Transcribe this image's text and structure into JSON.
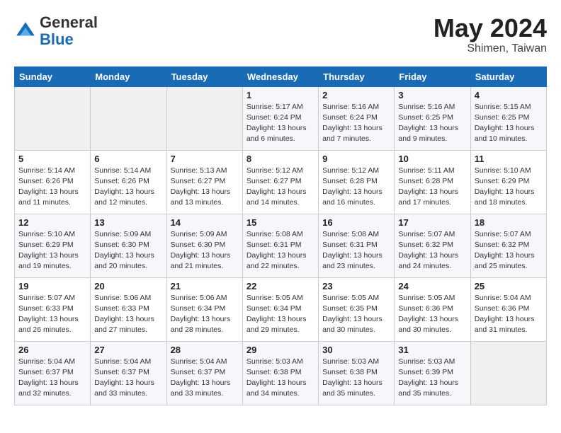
{
  "header": {
    "logo_general": "General",
    "logo_blue": "Blue",
    "month_title": "May 2024",
    "subtitle": "Shimen, Taiwan"
  },
  "days_of_week": [
    "Sunday",
    "Monday",
    "Tuesday",
    "Wednesday",
    "Thursday",
    "Friday",
    "Saturday"
  ],
  "weeks": [
    [
      {
        "day": "",
        "sunrise": "",
        "sunset": "",
        "daylight": ""
      },
      {
        "day": "",
        "sunrise": "",
        "sunset": "",
        "daylight": ""
      },
      {
        "day": "",
        "sunrise": "",
        "sunset": "",
        "daylight": ""
      },
      {
        "day": "1",
        "sunrise": "Sunrise: 5:17 AM",
        "sunset": "Sunset: 6:24 PM",
        "daylight": "Daylight: 13 hours and 6 minutes."
      },
      {
        "day": "2",
        "sunrise": "Sunrise: 5:16 AM",
        "sunset": "Sunset: 6:24 PM",
        "daylight": "Daylight: 13 hours and 7 minutes."
      },
      {
        "day": "3",
        "sunrise": "Sunrise: 5:16 AM",
        "sunset": "Sunset: 6:25 PM",
        "daylight": "Daylight: 13 hours and 9 minutes."
      },
      {
        "day": "4",
        "sunrise": "Sunrise: 5:15 AM",
        "sunset": "Sunset: 6:25 PM",
        "daylight": "Daylight: 13 hours and 10 minutes."
      }
    ],
    [
      {
        "day": "5",
        "sunrise": "Sunrise: 5:14 AM",
        "sunset": "Sunset: 6:26 PM",
        "daylight": "Daylight: 13 hours and 11 minutes."
      },
      {
        "day": "6",
        "sunrise": "Sunrise: 5:14 AM",
        "sunset": "Sunset: 6:26 PM",
        "daylight": "Daylight: 13 hours and 12 minutes."
      },
      {
        "day": "7",
        "sunrise": "Sunrise: 5:13 AM",
        "sunset": "Sunset: 6:27 PM",
        "daylight": "Daylight: 13 hours and 13 minutes."
      },
      {
        "day": "8",
        "sunrise": "Sunrise: 5:12 AM",
        "sunset": "Sunset: 6:27 PM",
        "daylight": "Daylight: 13 hours and 14 minutes."
      },
      {
        "day": "9",
        "sunrise": "Sunrise: 5:12 AM",
        "sunset": "Sunset: 6:28 PM",
        "daylight": "Daylight: 13 hours and 16 minutes."
      },
      {
        "day": "10",
        "sunrise": "Sunrise: 5:11 AM",
        "sunset": "Sunset: 6:28 PM",
        "daylight": "Daylight: 13 hours and 17 minutes."
      },
      {
        "day": "11",
        "sunrise": "Sunrise: 5:10 AM",
        "sunset": "Sunset: 6:29 PM",
        "daylight": "Daylight: 13 hours and 18 minutes."
      }
    ],
    [
      {
        "day": "12",
        "sunrise": "Sunrise: 5:10 AM",
        "sunset": "Sunset: 6:29 PM",
        "daylight": "Daylight: 13 hours and 19 minutes."
      },
      {
        "day": "13",
        "sunrise": "Sunrise: 5:09 AM",
        "sunset": "Sunset: 6:30 PM",
        "daylight": "Daylight: 13 hours and 20 minutes."
      },
      {
        "day": "14",
        "sunrise": "Sunrise: 5:09 AM",
        "sunset": "Sunset: 6:30 PM",
        "daylight": "Daylight: 13 hours and 21 minutes."
      },
      {
        "day": "15",
        "sunrise": "Sunrise: 5:08 AM",
        "sunset": "Sunset: 6:31 PM",
        "daylight": "Daylight: 13 hours and 22 minutes."
      },
      {
        "day": "16",
        "sunrise": "Sunrise: 5:08 AM",
        "sunset": "Sunset: 6:31 PM",
        "daylight": "Daylight: 13 hours and 23 minutes."
      },
      {
        "day": "17",
        "sunrise": "Sunrise: 5:07 AM",
        "sunset": "Sunset: 6:32 PM",
        "daylight": "Daylight: 13 hours and 24 minutes."
      },
      {
        "day": "18",
        "sunrise": "Sunrise: 5:07 AM",
        "sunset": "Sunset: 6:32 PM",
        "daylight": "Daylight: 13 hours and 25 minutes."
      }
    ],
    [
      {
        "day": "19",
        "sunrise": "Sunrise: 5:07 AM",
        "sunset": "Sunset: 6:33 PM",
        "daylight": "Daylight: 13 hours and 26 minutes."
      },
      {
        "day": "20",
        "sunrise": "Sunrise: 5:06 AM",
        "sunset": "Sunset: 6:33 PM",
        "daylight": "Daylight: 13 hours and 27 minutes."
      },
      {
        "day": "21",
        "sunrise": "Sunrise: 5:06 AM",
        "sunset": "Sunset: 6:34 PM",
        "daylight": "Daylight: 13 hours and 28 minutes."
      },
      {
        "day": "22",
        "sunrise": "Sunrise: 5:05 AM",
        "sunset": "Sunset: 6:34 PM",
        "daylight": "Daylight: 13 hours and 29 minutes."
      },
      {
        "day": "23",
        "sunrise": "Sunrise: 5:05 AM",
        "sunset": "Sunset: 6:35 PM",
        "daylight": "Daylight: 13 hours and 30 minutes."
      },
      {
        "day": "24",
        "sunrise": "Sunrise: 5:05 AM",
        "sunset": "Sunset: 6:36 PM",
        "daylight": "Daylight: 13 hours and 30 minutes."
      },
      {
        "day": "25",
        "sunrise": "Sunrise: 5:04 AM",
        "sunset": "Sunset: 6:36 PM",
        "daylight": "Daylight: 13 hours and 31 minutes."
      }
    ],
    [
      {
        "day": "26",
        "sunrise": "Sunrise: 5:04 AM",
        "sunset": "Sunset: 6:37 PM",
        "daylight": "Daylight: 13 hours and 32 minutes."
      },
      {
        "day": "27",
        "sunrise": "Sunrise: 5:04 AM",
        "sunset": "Sunset: 6:37 PM",
        "daylight": "Daylight: 13 hours and 33 minutes."
      },
      {
        "day": "28",
        "sunrise": "Sunrise: 5:04 AM",
        "sunset": "Sunset: 6:37 PM",
        "daylight": "Daylight: 13 hours and 33 minutes."
      },
      {
        "day": "29",
        "sunrise": "Sunrise: 5:03 AM",
        "sunset": "Sunset: 6:38 PM",
        "daylight": "Daylight: 13 hours and 34 minutes."
      },
      {
        "day": "30",
        "sunrise": "Sunrise: 5:03 AM",
        "sunset": "Sunset: 6:38 PM",
        "daylight": "Daylight: 13 hours and 35 minutes."
      },
      {
        "day": "31",
        "sunrise": "Sunrise: 5:03 AM",
        "sunset": "Sunset: 6:39 PM",
        "daylight": "Daylight: 13 hours and 35 minutes."
      },
      {
        "day": "",
        "sunrise": "",
        "sunset": "",
        "daylight": ""
      }
    ]
  ]
}
